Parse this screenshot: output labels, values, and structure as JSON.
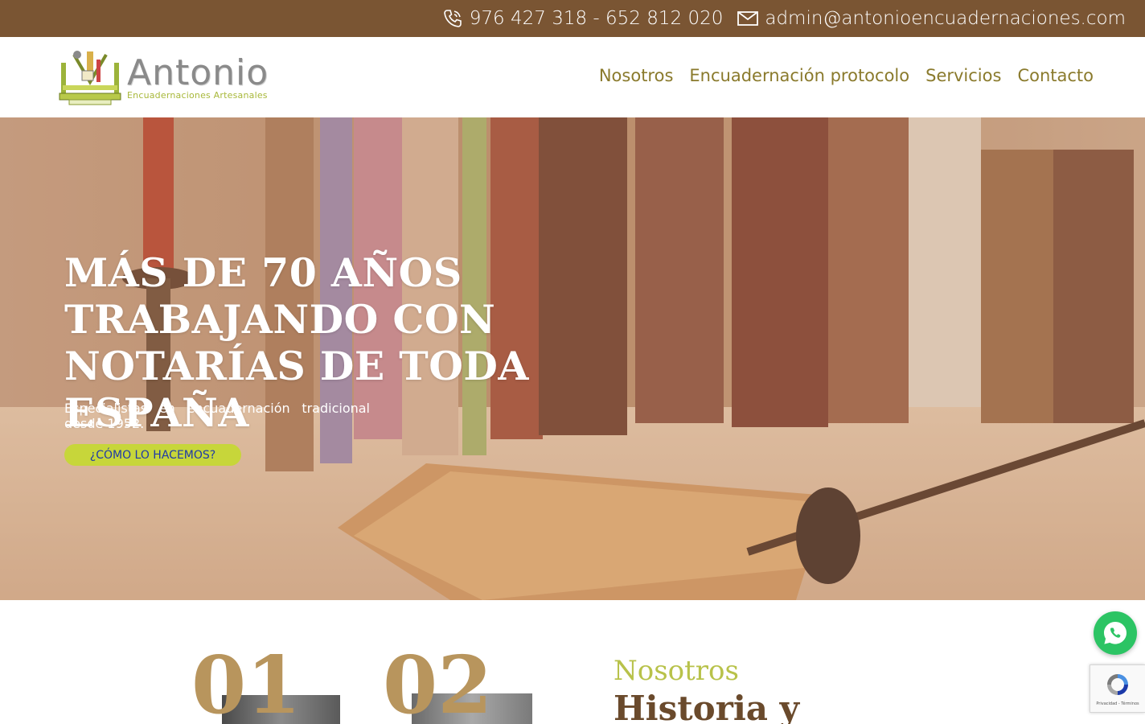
{
  "topbar": {
    "phone": "976 427 318 - 652 812 020",
    "email": "admin@antonioencuadernaciones.com"
  },
  "header": {
    "logo_name": "Antonio",
    "logo_sub": "Encuadernaciones Artesanales",
    "nav": [
      "Nosotros",
      "Encuadernación protocolo",
      "Servicios",
      "Contacto"
    ]
  },
  "hero": {
    "title": "MÁS DE 70 AÑOS TRABAJANDO CON NOTARÍAS DE TODA ESPAÑA",
    "text": "Especialistas en encuadernación tradicional desde 1952.",
    "button": "¿CÓMO LO HACEMOS?"
  },
  "section": {
    "num1": "01",
    "num2": "02",
    "kicker": "Nosotros",
    "title": "Historia y"
  },
  "recaptcha": {
    "terms": "Privacidad - Términos"
  },
  "icons": {
    "phone": "phone-icon",
    "email": "envelope-icon",
    "whatsapp": "whatsapp-icon",
    "recaptcha": "recaptcha-icon"
  },
  "colors": {
    "topbar": "#7a5533",
    "nav": "#8a7a2c",
    "accent_green": "#c7d63a",
    "number_gold": "#b8955d"
  }
}
